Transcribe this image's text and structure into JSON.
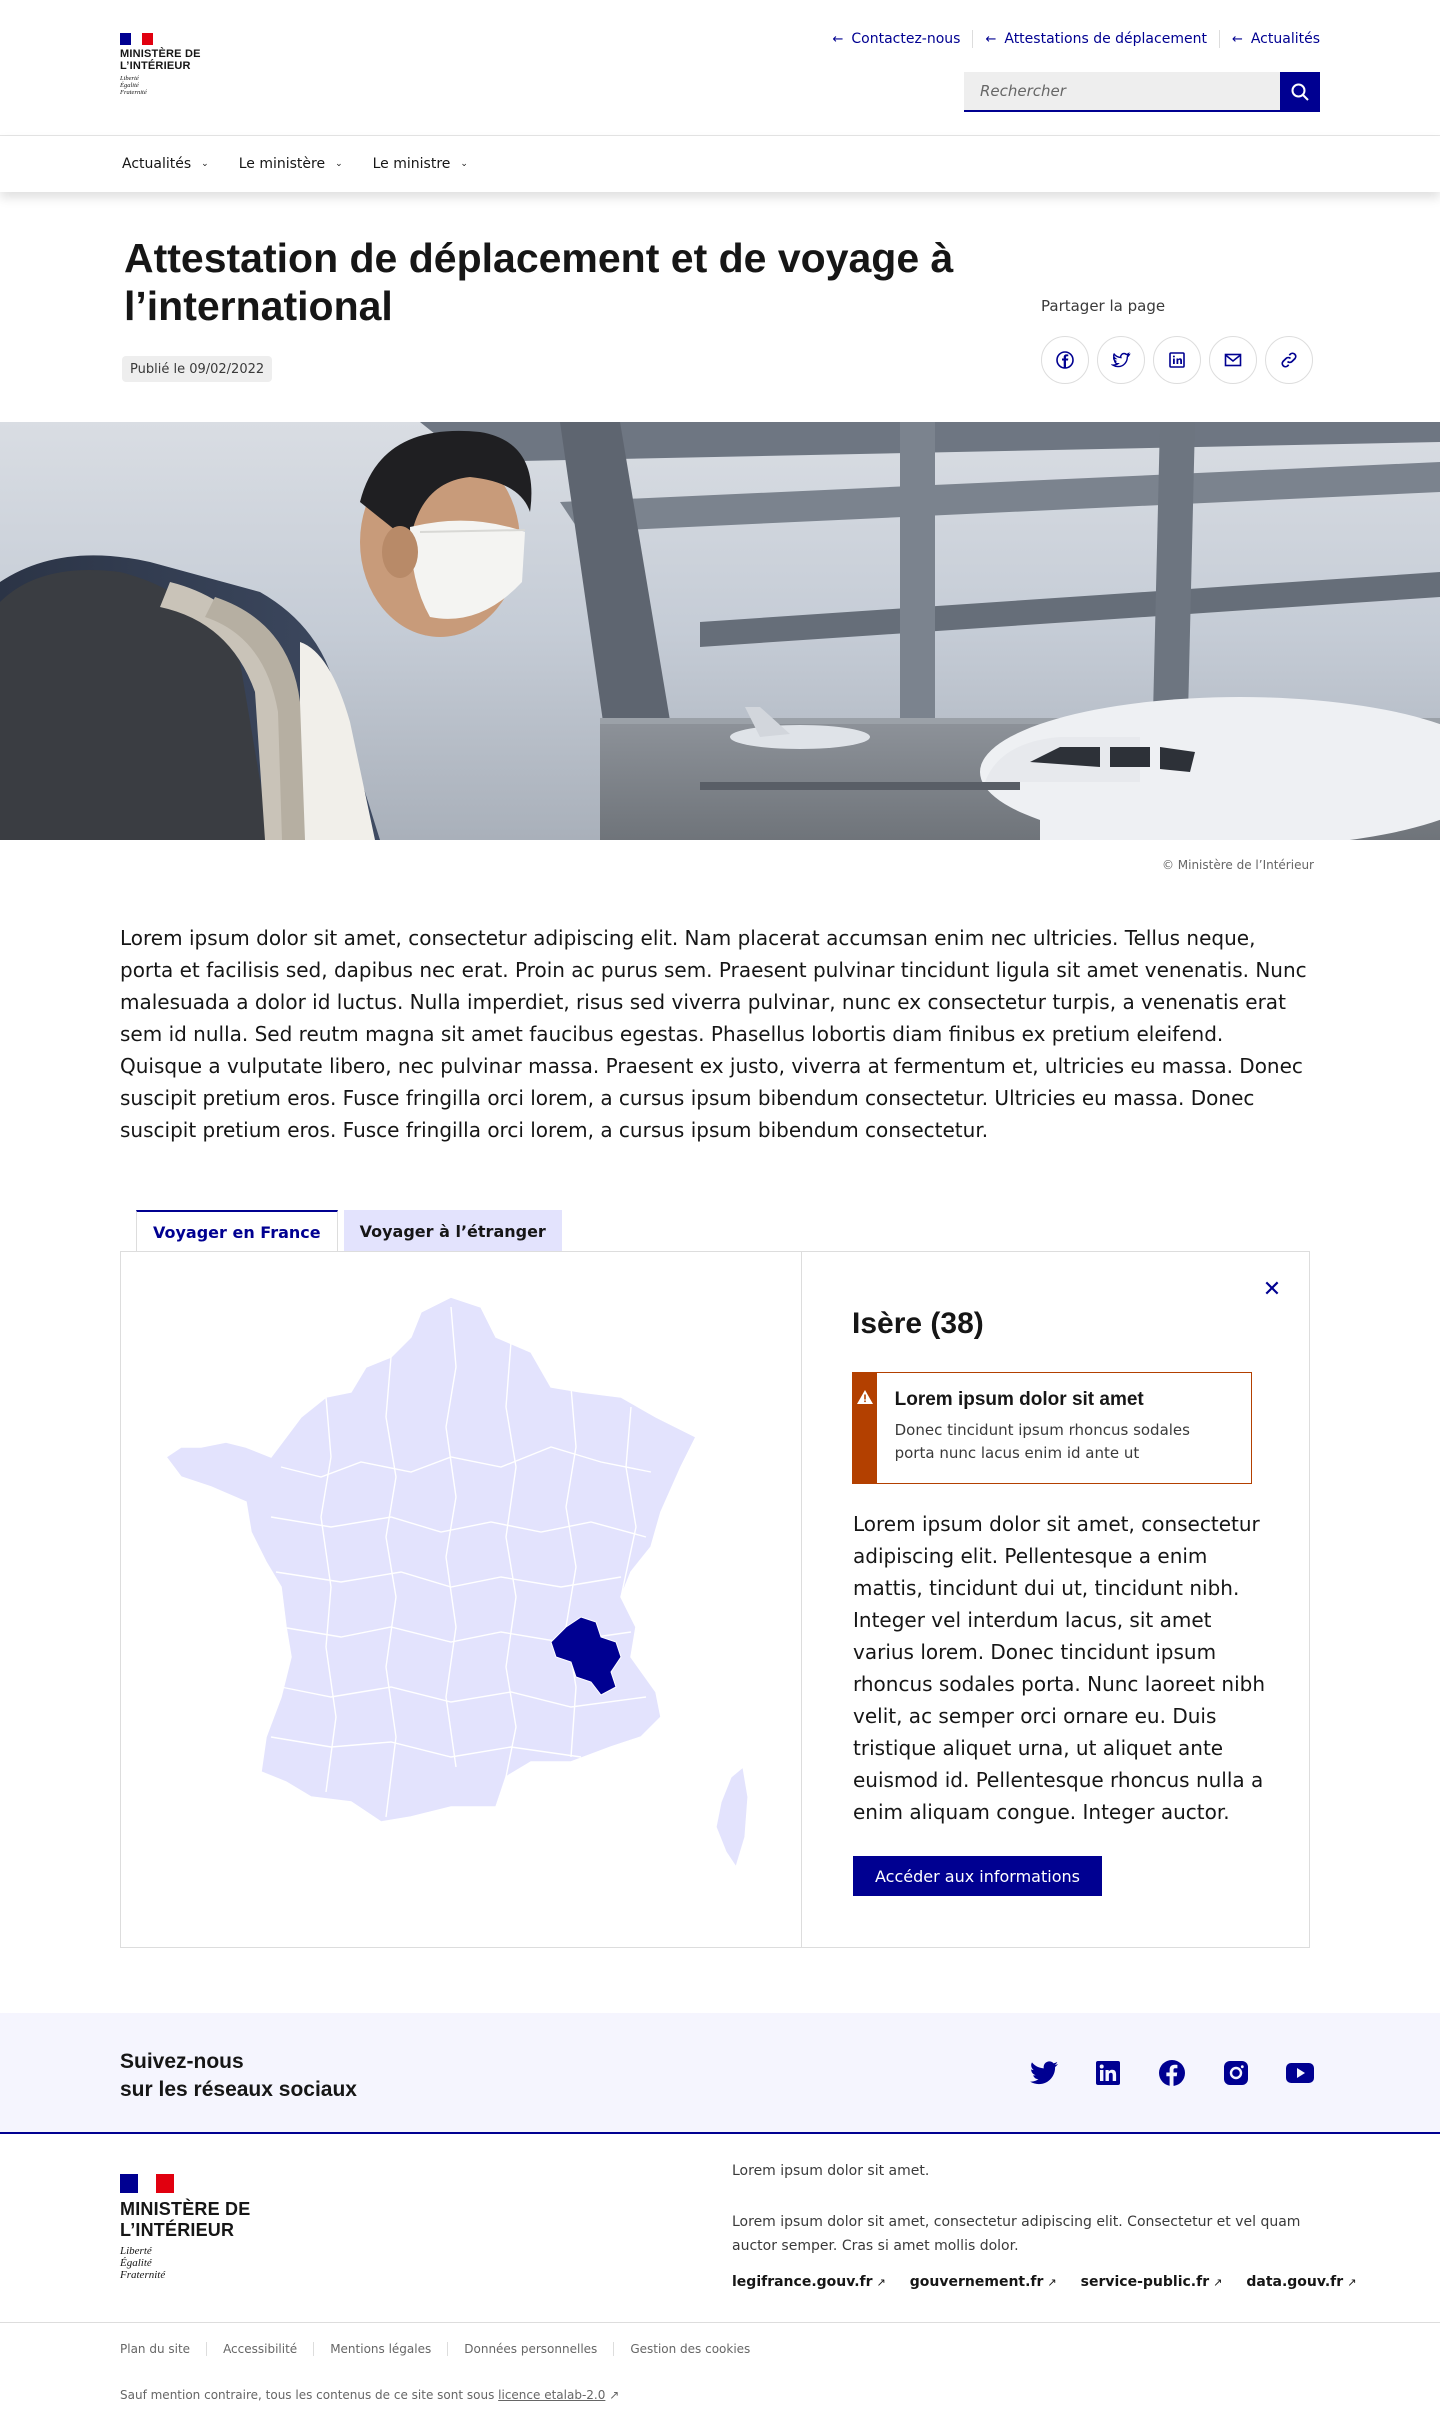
{
  "brand": {
    "title_line1": "MINISTÈRE DE",
    "title_line2": "L’INTÉRIEUR",
    "motto": [
      "Liberté",
      "Égalité",
      "Fraternité"
    ],
    "flag_colors": [
      "#000091",
      "#ffffff",
      "#e1000f"
    ]
  },
  "header": {
    "top_links": [
      "Contactez-nous",
      "Attestations de déplacement",
      "Actualités"
    ],
    "search_placeholder": "Rechercher",
    "nav": [
      "Actualités",
      "Le ministère",
      "Le ministre"
    ]
  },
  "page": {
    "title": "Attestation de déplacement et de voyage à l’international",
    "published": "Publié le 09/02/2022",
    "share_label": "Partager la page",
    "share_icons": [
      "facebook-icon",
      "twitter-icon",
      "linkedin-icon",
      "mail-icon",
      "link-icon"
    ],
    "image_credit": "© Ministère de l’Intérieur",
    "intro": "Lorem ipsum dolor sit amet, consectetur adipiscing elit. Nam placerat accumsan enim nec ultricies. Tellus neque, porta et facilisis sed, dapibus nec erat. Proin ac purus sem. Praesent pulvinar tincidunt ligula sit amet venenatis. Nunc malesuada a dolor id luctus. Nulla imperdiet, risus sed viverra pulvinar, nunc ex consectetur turpis, a venenatis erat sem id nulla. Sed reutm magna sit amet faucibus egestas. Phasellus lobortis diam finibus ex pretium eleifend. Quisque a vulputate libero, nec pulvinar massa. Praesent ex justo, viverra at fermentum et, ultricies eu massa. Donec suscipit pretium eros. Fusce fringilla orci lorem, a cursus ipsum bibendum consectetur. Ultricies eu massa. Donec suscipit pretium eros. Fusce fringilla orci lorem, a cursus ipsum bibendum consectetur."
  },
  "tabs": [
    {
      "label": "Voyager en France",
      "active": true
    },
    {
      "label": "Voyager à l’étranger",
      "active": false
    }
  ],
  "map_panel": {
    "department": "Isère (38)",
    "alert_title": "Lorem ipsum dolor sit amet",
    "alert_text": "Donec tincidunt ipsum rhoncus sodales porta nunc lacus enim id ante ut",
    "body": "Lorem ipsum dolor sit amet, consectetur adipiscing elit. Pellentesque a enim mattis, tincidunt dui ut, tincidunt nibh. Integer vel interdum lacus, sit amet varius lorem. Donec tincidunt ipsum rhoncus sodales porta. Nunc laoreet nibh velit, ac semper orci ornare eu. Duis tristique aliquet urna, ut aliquet ante euismod id. Pellentesque rhoncus nulla a enim aliquam congue. Integer auctor.",
    "cta": "Accéder aux informations",
    "map_color": "#e3e3fd",
    "highlight_color": "#000091"
  },
  "follow": {
    "title_line1": "Suivez-nous",
    "title_line2": "sur les réseaux sociaux",
    "icons": [
      "twitter-icon",
      "linkedin-icon",
      "facebook-icon",
      "instagram-icon",
      "youtube-icon"
    ]
  },
  "footer": {
    "desc1": "Lorem ipsum dolor sit amet.",
    "desc2": "Lorem ipsum dolor sit amet, consectetur adipiscing elit. Consectetur et vel quam auctor semper. Cras si amet mollis dolor.",
    "links": [
      "legifrance.gouv.fr",
      "gouvernement.fr",
      "service-public.fr",
      "data.gouv.fr"
    ],
    "bottom_links": [
      "Plan du site",
      "Accessibilité",
      "Mentions légales",
      "Données personnelles",
      "Gestion des cookies"
    ],
    "licence_prefix": "Sauf mention contraire, tous les contenus de ce site sont sous",
    "licence_link": "licence etalab-2.0"
  }
}
